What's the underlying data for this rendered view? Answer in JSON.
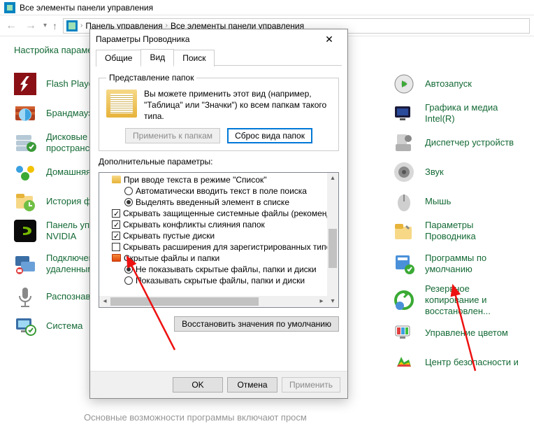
{
  "cp": {
    "title": "Все элементы панели управления",
    "breadcrumb": [
      "Панель управления",
      "Все элементы панели управления"
    ],
    "heading": "Настройка параметров компьютера",
    "left_items": [
      {
        "name": "flash",
        "label": "Flash Player"
      },
      {
        "name": "firewall",
        "label": "Брандмауэр Windows"
      },
      {
        "name": "storage",
        "label": "Дисковые пространства"
      },
      {
        "name": "homegroup",
        "label": "Домашняя группа"
      },
      {
        "name": "filehistory",
        "label": "История файлов"
      },
      {
        "name": "nvidia",
        "label": "Панель управления NVIDIA"
      },
      {
        "name": "remoteapp",
        "label": "Подключения к удаленным рабочим..."
      },
      {
        "name": "speech",
        "label": "Распознавание речи"
      },
      {
        "name": "system",
        "label": "Система"
      }
    ],
    "right_items": [
      {
        "name": "autoplay",
        "label": "Автозапуск"
      },
      {
        "name": "intel-gfx",
        "label": "Графика и медиа Intel(R)"
      },
      {
        "name": "devmgr",
        "label": "Диспетчер устройств"
      },
      {
        "name": "sound",
        "label": "Звук"
      },
      {
        "name": "mouse",
        "label": "Мышь"
      },
      {
        "name": "explorer-options",
        "label": "Параметры Проводника"
      },
      {
        "name": "default-programs",
        "label": "Программы по умолчанию"
      },
      {
        "name": "backup",
        "label": "Резервное копирование и восстановлен..."
      },
      {
        "name": "color",
        "label": "Управление цветом"
      },
      {
        "name": "security",
        "label": "Центр безопасности и"
      }
    ],
    "footer": "Основные возможности программы включают просм"
  },
  "dlg": {
    "title": "Параметры Проводника",
    "tabs": {
      "general": "Общие",
      "view": "Вид",
      "search": "Поиск"
    },
    "group_title": "Представление папок",
    "fv_text": "Вы можете применить этот вид (например, \"Таблица\" или \"Значки\") ко всем папкам такого типа.",
    "btn_apply_folders": "Применить к папкам",
    "btn_reset_folders": "Сброс вида папок",
    "adv_label": "Дополнительные параметры:",
    "tree": {
      "n1": "При вводе текста в режиме \"Список\"",
      "n1a": "Автоматически вводить текст в поле поиска",
      "n1b": "Выделять введенный элемент в списке",
      "n2": "Скрывать защищенные системные файлы (рекомендуется)",
      "n3": "Скрывать конфликты слияния папок",
      "n4": "Скрывать пустые диски",
      "n5": "Скрывать расширения для зарегистрированных типов файлов",
      "n6": "Скрытые файлы и папки",
      "n6a": "Не показывать скрытые файлы, папки и диски",
      "n6b": "Показывать скрытые файлы, папки и диски"
    },
    "btn_restore": "Восстановить значения по умолчанию",
    "btn_ok": "OK",
    "btn_cancel": "Отмена",
    "btn_apply": "Применить"
  }
}
